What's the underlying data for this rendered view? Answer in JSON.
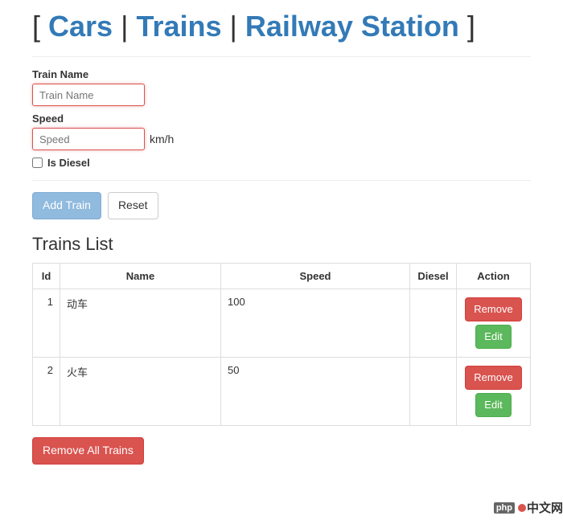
{
  "header": {
    "open_bracket": "[ ",
    "close_bracket": " ]",
    "pipe": " | ",
    "links": [
      "Cars",
      "Trains",
      "Railway Station"
    ]
  },
  "form": {
    "train_name_label": "Train Name",
    "train_name_placeholder": "Train Name",
    "train_name_value": "",
    "speed_label": "Speed",
    "speed_placeholder": "Speed",
    "speed_value": "",
    "speed_unit": "km/h",
    "is_diesel_label": "Is Diesel",
    "is_diesel_checked": false,
    "add_button": "Add Train",
    "reset_button": "Reset"
  },
  "list": {
    "title": "Trains List",
    "headers": {
      "id": "Id",
      "name": "Name",
      "speed": "Speed",
      "diesel": "Diesel",
      "action": "Action"
    },
    "action_labels": {
      "remove": "Remove",
      "edit": "Edit"
    },
    "rows": [
      {
        "id": "1",
        "name": "动车",
        "speed": "100",
        "diesel": ""
      },
      {
        "id": "2",
        "name": "火车",
        "speed": "50",
        "diesel": ""
      }
    ],
    "remove_all_button": "Remove All Trains"
  },
  "watermark": {
    "logo_small": "php",
    "text": "中文网"
  }
}
